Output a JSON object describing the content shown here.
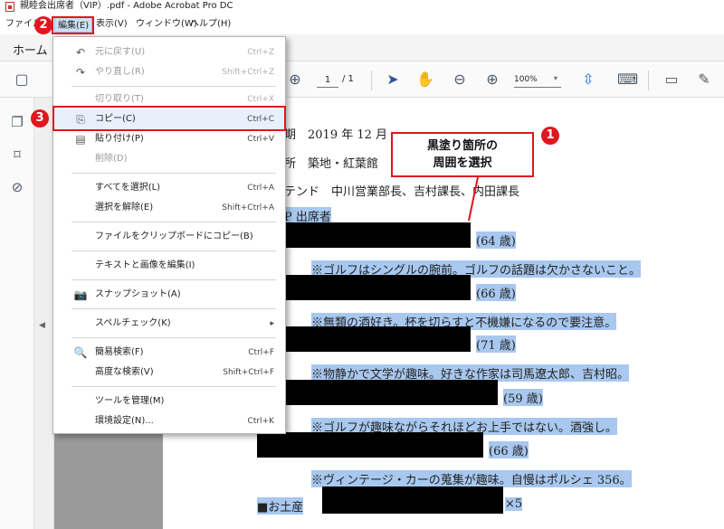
{
  "window": {
    "title": "親睦会出席者（VIP）.pdf - Adobe Acrobat Pro DC"
  },
  "menubar": [
    "ファイル(F)",
    "編集(E)",
    "表示(V)",
    "ウィンドウ(W)",
    "ヘルプ(H)"
  ],
  "tabs": {
    "home": "ホーム"
  },
  "toolbar": {
    "page_current": "1",
    "page_total": "/ 1",
    "zoom": "100%"
  },
  "edit_menu": {
    "items": [
      {
        "label": "元に戻す(U)",
        "shortcut": "Ctrl+Z",
        "disabled": true
      },
      {
        "label": "やり直し(R)",
        "shortcut": "Shift+Ctrl+Z",
        "disabled": true
      },
      {
        "label": "切り取り(T)",
        "shortcut": "Ctrl+X",
        "disabled": true
      },
      {
        "label": "コピー(C)",
        "shortcut": "Ctrl+C",
        "disabled": false
      },
      {
        "label": "貼り付け(P)",
        "shortcut": "Ctrl+V",
        "disabled": false
      },
      {
        "label": "削除(D)",
        "shortcut": "",
        "disabled": true
      },
      {
        "label": "すべてを選択(L)",
        "shortcut": "Ctrl+A",
        "disabled": false
      },
      {
        "label": "選択を解除(E)",
        "shortcut": "Shift+Ctrl+A",
        "disabled": false
      },
      {
        "label": "ファイルをクリップボードにコピー(B)",
        "shortcut": "",
        "disabled": false
      },
      {
        "label": "テキストと画像を編集(I)",
        "shortcut": "",
        "disabled": false
      },
      {
        "label": "スナップショット(A)",
        "shortcut": "",
        "disabled": false
      },
      {
        "label": "スペルチェック(K)",
        "shortcut": "▸",
        "disabled": false
      },
      {
        "label": "簡易検索(F)",
        "shortcut": "Ctrl+F",
        "disabled": false
      },
      {
        "label": "高度な検索(V)",
        "shortcut": "Shift+Ctrl+F",
        "disabled": false
      },
      {
        "label": "ツールを管理(M)",
        "shortcut": "",
        "disabled": false
      },
      {
        "label": "環境設定(N)...",
        "shortcut": "Ctrl+K",
        "disabled": false
      }
    ]
  },
  "document": {
    "line_date": "期　2019 年 12 月",
    "line_place": "所　築地・紅葉館",
    "line_attend": "テンド　中川営業部長、吉村課長、内田課長",
    "line_vip": "P 出席者",
    "ages": [
      "(64 歳)",
      "(66 歳)",
      "(71 歳)",
      "(59 歳)",
      "(66 歳)"
    ],
    "notes": [
      "※ゴルフはシングルの腕前。ゴルフの話題は欠かさないこと。",
      "※無類の酒好き。杯を切らすと不機嫌になるので要注意。",
      "※物静かで文学が趣味。好きな作家は司馬遼太郎、吉村昭。",
      "※ゴルフが趣味ながらそれほどお上手ではない。酒強し。",
      "※ヴィンテージ・カーの蒐集が趣味。自慢はポルシェ 356。"
    ],
    "souvenir_label": "■お土産",
    "souvenir_count": "×5"
  },
  "annotations": {
    "callout": "黒塗り箇所の\n周囲を選択",
    "badge1": "1",
    "badge2": "2",
    "badge3": "3",
    "color": "#e0161e"
  }
}
